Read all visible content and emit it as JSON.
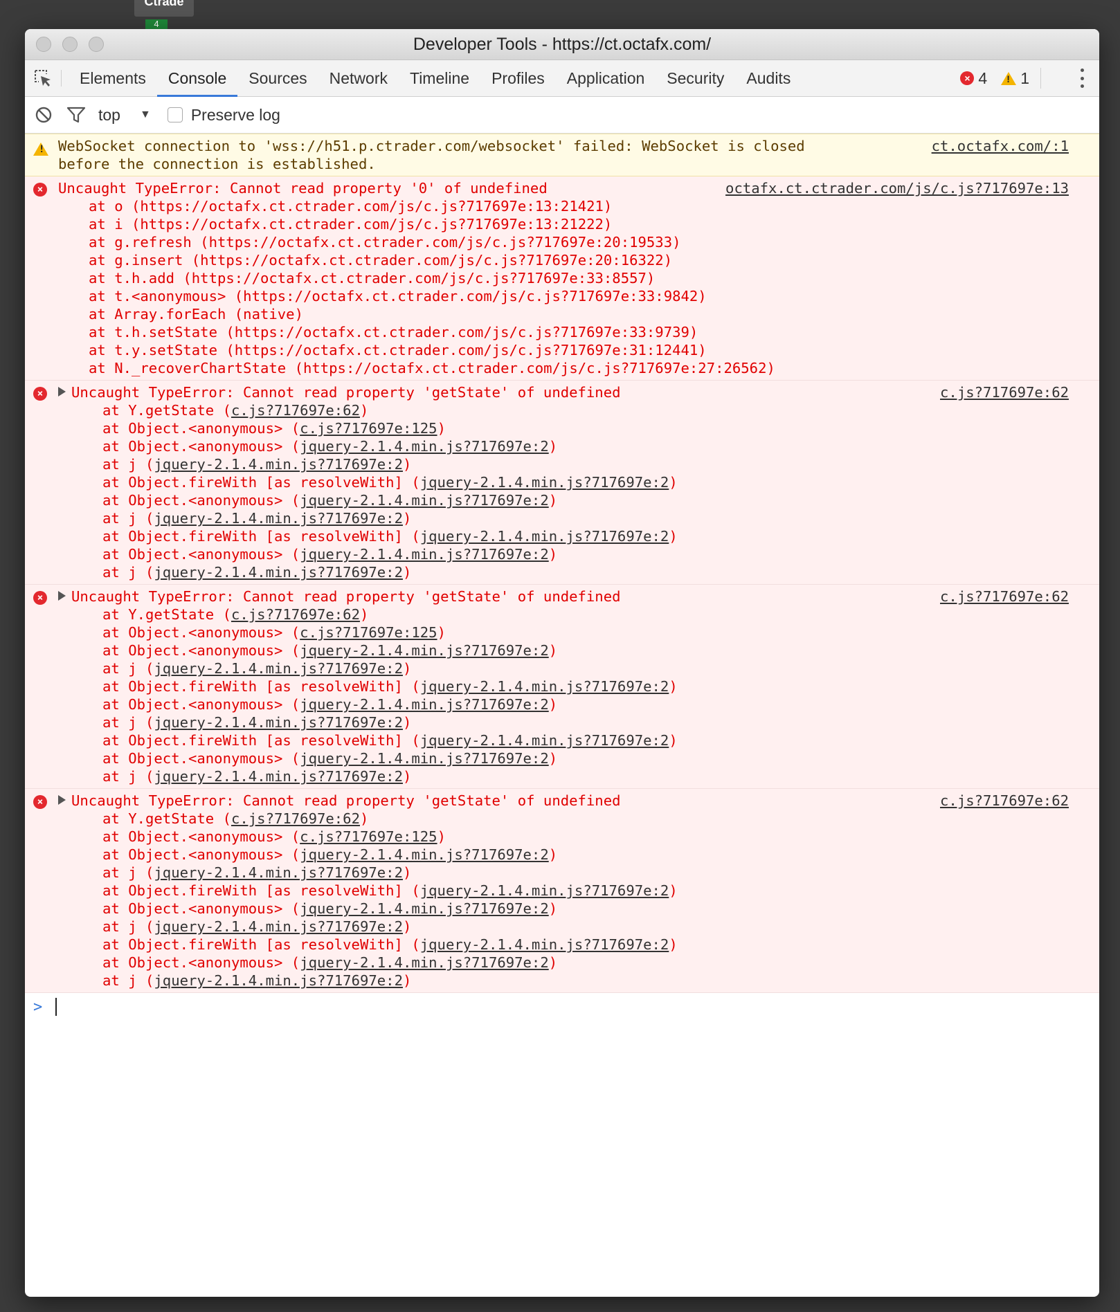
{
  "background_tab": {
    "label": "Ctrade",
    "badge": "4"
  },
  "window": {
    "title": "Developer Tools - https://ct.octafx.com/"
  },
  "tabs": [
    "Elements",
    "Console",
    "Sources",
    "Network",
    "Timeline",
    "Profiles",
    "Application",
    "Security",
    "Audits"
  ],
  "active_tab": "Console",
  "counts": {
    "errors": "4",
    "warnings": "1"
  },
  "filter": {
    "context": "top",
    "preserve_log_label": "Preserve log",
    "preserve_log_checked": false
  },
  "messages": [
    {
      "level": "warning",
      "lines": [
        "WebSocket connection to 'wss://h51.p.ctrader.com/websocket' failed: WebSocket is closed",
        "before the connection is established."
      ],
      "source": "ct.octafx.com/:1",
      "expandable": false,
      "frames": []
    },
    {
      "level": "error",
      "lines": [
        "Uncaught TypeError: Cannot read property '0' of undefined"
      ],
      "source": "octafx.ct.ctrader.com/js/c.js?717697e:13",
      "expandable": false,
      "frames": [
        {
          "text": "at o (https://octafx.ct.ctrader.com/js/c.js?717697e:13:21421)",
          "link": ""
        },
        {
          "text": "at i (https://octafx.ct.ctrader.com/js/c.js?717697e:13:21222)",
          "link": ""
        },
        {
          "text": "at g.refresh (https://octafx.ct.ctrader.com/js/c.js?717697e:20:19533)",
          "link": ""
        },
        {
          "text": "at g.insert (https://octafx.ct.ctrader.com/js/c.js?717697e:20:16322)",
          "link": ""
        },
        {
          "text": "at t.h.add (https://octafx.ct.ctrader.com/js/c.js?717697e:33:8557)",
          "link": ""
        },
        {
          "text": "at t.<anonymous> (https://octafx.ct.ctrader.com/js/c.js?717697e:33:9842)",
          "link": ""
        },
        {
          "text": "at Array.forEach (native)",
          "link": ""
        },
        {
          "text": "at t.h.setState (https://octafx.ct.ctrader.com/js/c.js?717697e:33:9739)",
          "link": ""
        },
        {
          "text": "at t.y.setState (https://octafx.ct.ctrader.com/js/c.js?717697e:31:12441)",
          "link": ""
        },
        {
          "text": "at N._recoverChartState (https://octafx.ct.ctrader.com/js/c.js?717697e:27:26562)",
          "link": ""
        }
      ]
    },
    {
      "level": "error",
      "lines": [
        "Uncaught TypeError: Cannot read property 'getState' of undefined"
      ],
      "source": "c.js?717697e:62",
      "expandable": true,
      "frames": [
        {
          "text": "at Y.getState (",
          "link": "c.js?717697e:62"
        },
        {
          "text": "at Object.<anonymous> (",
          "link": "c.js?717697e:125"
        },
        {
          "text": "at Object.<anonymous> (",
          "link": "jquery-2.1.4.min.js?717697e:2"
        },
        {
          "text": "at j (",
          "link": "jquery-2.1.4.min.js?717697e:2"
        },
        {
          "text": "at Object.fireWith [as resolveWith] (",
          "link": "jquery-2.1.4.min.js?717697e:2"
        },
        {
          "text": "at Object.<anonymous> (",
          "link": "jquery-2.1.4.min.js?717697e:2"
        },
        {
          "text": "at j (",
          "link": "jquery-2.1.4.min.js?717697e:2"
        },
        {
          "text": "at Object.fireWith [as resolveWith] (",
          "link": "jquery-2.1.4.min.js?717697e:2"
        },
        {
          "text": "at Object.<anonymous> (",
          "link": "jquery-2.1.4.min.js?717697e:2"
        },
        {
          "text": "at j (",
          "link": "jquery-2.1.4.min.js?717697e:2"
        }
      ]
    },
    {
      "level": "error",
      "lines": [
        "Uncaught TypeError: Cannot read property 'getState' of undefined"
      ],
      "source": "c.js?717697e:62",
      "expandable": true,
      "frames": [
        {
          "text": "at Y.getState (",
          "link": "c.js?717697e:62"
        },
        {
          "text": "at Object.<anonymous> (",
          "link": "c.js?717697e:125"
        },
        {
          "text": "at Object.<anonymous> (",
          "link": "jquery-2.1.4.min.js?717697e:2"
        },
        {
          "text": "at j (",
          "link": "jquery-2.1.4.min.js?717697e:2"
        },
        {
          "text": "at Object.fireWith [as resolveWith] (",
          "link": "jquery-2.1.4.min.js?717697e:2"
        },
        {
          "text": "at Object.<anonymous> (",
          "link": "jquery-2.1.4.min.js?717697e:2"
        },
        {
          "text": "at j (",
          "link": "jquery-2.1.4.min.js?717697e:2"
        },
        {
          "text": "at Object.fireWith [as resolveWith] (",
          "link": "jquery-2.1.4.min.js?717697e:2"
        },
        {
          "text": "at Object.<anonymous> (",
          "link": "jquery-2.1.4.min.js?717697e:2"
        },
        {
          "text": "at j (",
          "link": "jquery-2.1.4.min.js?717697e:2"
        }
      ]
    },
    {
      "level": "error",
      "lines": [
        "Uncaught TypeError: Cannot read property 'getState' of undefined"
      ],
      "source": "c.js?717697e:62",
      "expandable": true,
      "frames": [
        {
          "text": "at Y.getState (",
          "link": "c.js?717697e:62"
        },
        {
          "text": "at Object.<anonymous> (",
          "link": "c.js?717697e:125"
        },
        {
          "text": "at Object.<anonymous> (",
          "link": "jquery-2.1.4.min.js?717697e:2"
        },
        {
          "text": "at j (",
          "link": "jquery-2.1.4.min.js?717697e:2"
        },
        {
          "text": "at Object.fireWith [as resolveWith] (",
          "link": "jquery-2.1.4.min.js?717697e:2"
        },
        {
          "text": "at Object.<anonymous> (",
          "link": "jquery-2.1.4.min.js?717697e:2"
        },
        {
          "text": "at j (",
          "link": "jquery-2.1.4.min.js?717697e:2"
        },
        {
          "text": "at Object.fireWith [as resolveWith] (",
          "link": "jquery-2.1.4.min.js?717697e:2"
        },
        {
          "text": "at Object.<anonymous> (",
          "link": "jquery-2.1.4.min.js?717697e:2"
        },
        {
          "text": "at j (",
          "link": "jquery-2.1.4.min.js?717697e:2"
        }
      ]
    }
  ],
  "prompt": {
    "symbol": ">"
  },
  "colors": {
    "accent": "#3879d9",
    "error_text": "#e00000",
    "error_bg": "#fff0f0",
    "warning_bg": "#fffbe5"
  }
}
